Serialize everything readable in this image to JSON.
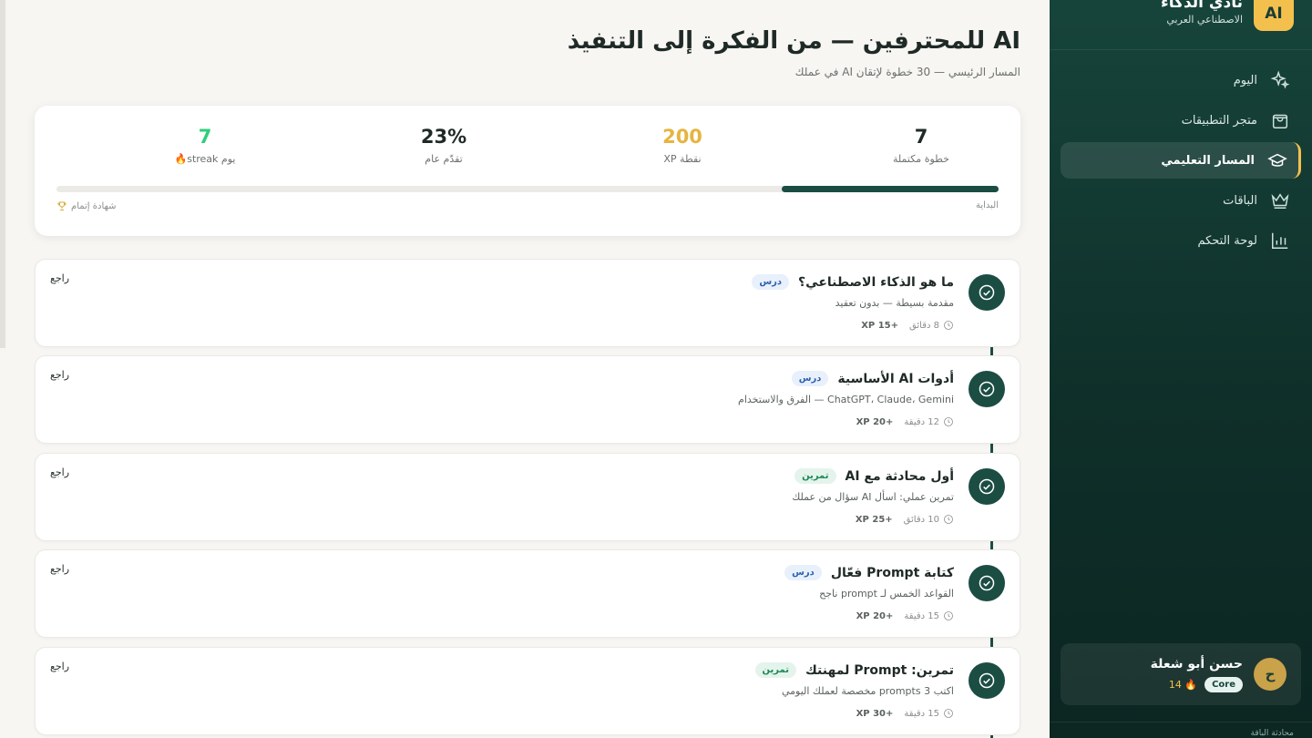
{
  "brand": {
    "logo_text": "AI",
    "name": "نادي الذكاء",
    "subtitle": "الاصطناعي العربي"
  },
  "nav": [
    {
      "label": "اليوم",
      "icon": "sparkles-icon",
      "name": "nav-item-today",
      "active": false
    },
    {
      "label": "متجر التطبيقات",
      "icon": "shopping-bag-icon",
      "name": "nav-item-app-store",
      "active": false
    },
    {
      "label": "المسار التعليمي",
      "icon": "graduation-cap-icon",
      "name": "nav-item-learning-path",
      "active": true
    },
    {
      "label": "الباقات",
      "icon": "crown-icon",
      "name": "nav-item-plans",
      "active": false
    },
    {
      "label": "لوحة التحكم",
      "icon": "bar-chart-icon",
      "name": "nav-item-dashboard",
      "active": false
    }
  ],
  "user": {
    "initial": "ح",
    "name": "حسن أبو شعلة",
    "plan": "Core",
    "points": "14"
  },
  "footer": {
    "text": "محادثة الباقة"
  },
  "page": {
    "title": "AI للمحترفين — من الفكرة إلى التنفيذ",
    "subtitle": "المسار الرئيسي — 30 خطوة لإتقان AI في عملك"
  },
  "stats": {
    "completed": {
      "value": "7",
      "label": "خطوة مكتملة",
      "color": "#1f2a27"
    },
    "xp": {
      "value": "200",
      "label": "نقطة XP",
      "color": "#e6b440"
    },
    "progress": {
      "value": "23%",
      "label": "تقدّم عام",
      "color": "#1f2a27"
    },
    "streak": {
      "value": "7",
      "label": "يوم streak🔥",
      "color": "#2fce7a"
    },
    "progress_fraction": 0.23,
    "start_label": "البداية",
    "end_label": "شهادة إتمام",
    "end_icon": "trophy-icon"
  },
  "steps": [
    {
      "title": "ما هو الذكاء الاصطناعي؟",
      "tag": "درس",
      "tag_type": "lesson",
      "desc": "مقدمة بسيطة — بدون تعقيد",
      "duration": "8 دقائق",
      "xp": "+15 XP",
      "review": "راجع"
    },
    {
      "title": "أدوات AI الأساسية",
      "tag": "درس",
      "tag_type": "lesson",
      "desc": "ChatGPT، Claude، Gemini — الفرق والاستخدام",
      "duration": "12 دقيقة",
      "xp": "+20 XP",
      "review": "راجع"
    },
    {
      "title": "أول محادثة مع AI",
      "tag": "تمرين",
      "tag_type": "exercise",
      "desc": "تمرين عملي: اسأل AI سؤال من عملك",
      "duration": "10 دقائق",
      "xp": "+25 XP",
      "review": "راجع"
    },
    {
      "title": "كتابة Prompt فعّال",
      "tag": "درس",
      "tag_type": "lesson",
      "desc": "القواعد الخمس لـ prompt ناجح",
      "duration": "15 دقيقة",
      "xp": "+20 XP",
      "review": "راجع"
    },
    {
      "title": "تمرين: Prompt لمهنتك",
      "tag": "تمرين",
      "tag_type": "exercise",
      "desc": "اكتب 3 prompts مخصصة لعملك اليومي",
      "duration": "15 دقيقة",
      "xp": "+30 XP",
      "review": "راجع"
    }
  ]
}
